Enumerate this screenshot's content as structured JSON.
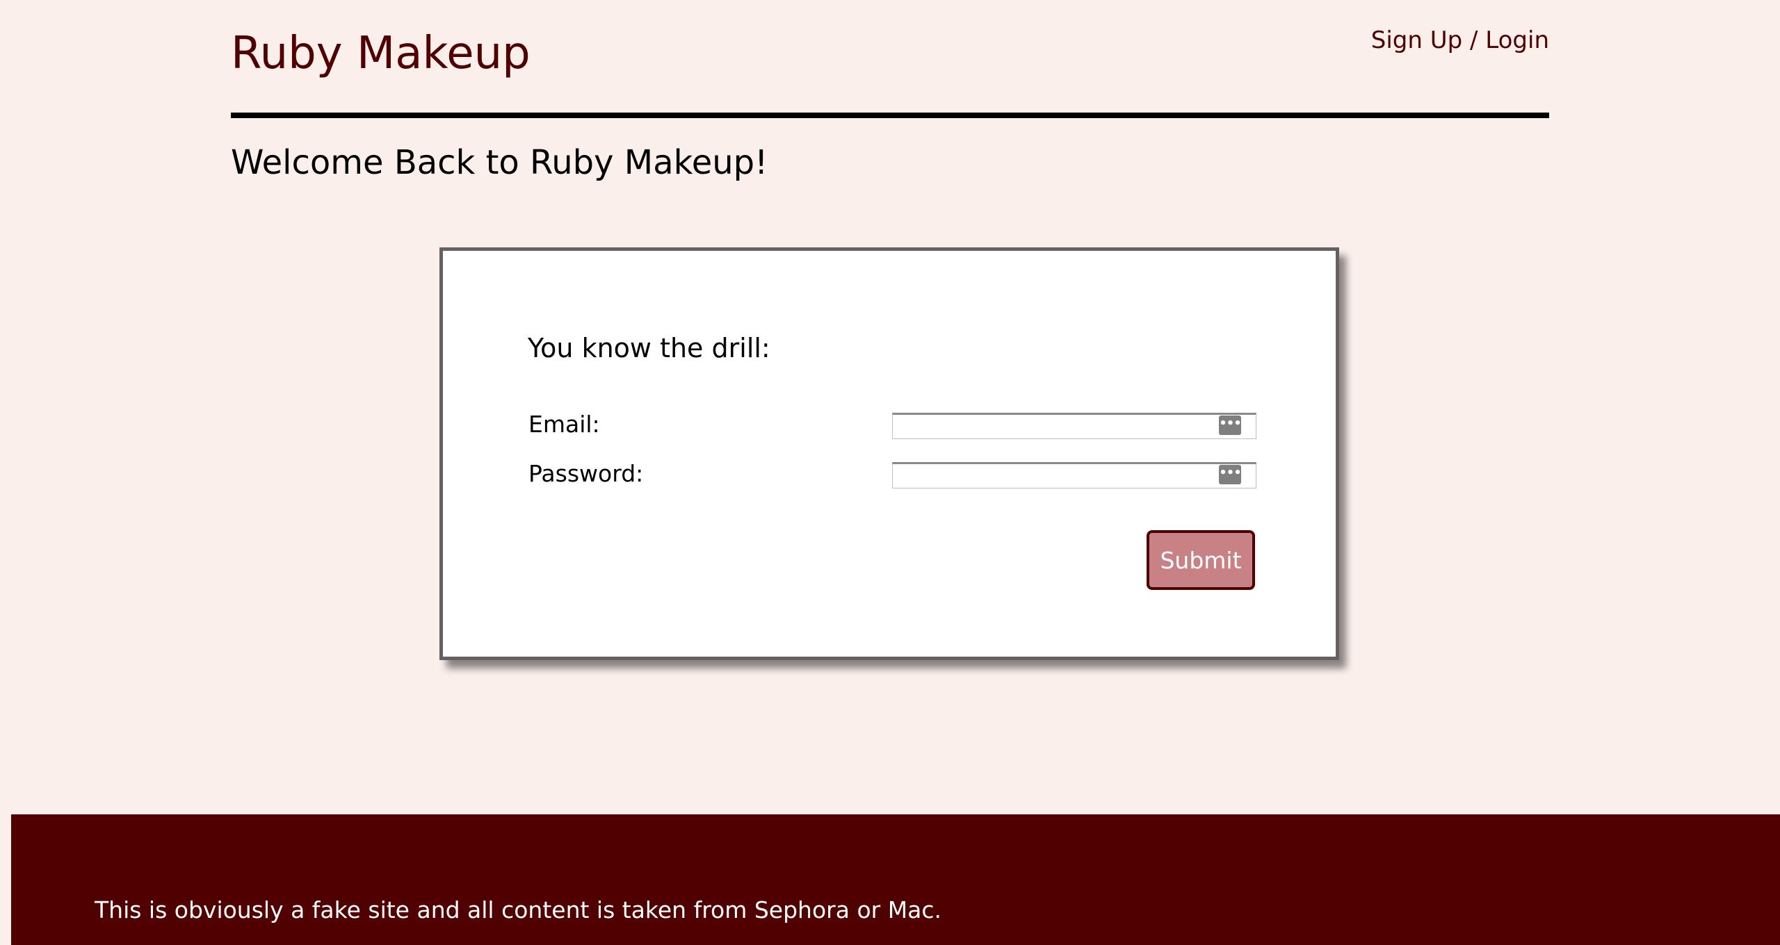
{
  "header": {
    "site_title": "Ruby Makeup",
    "auth_link": "Sign Up / Login"
  },
  "main": {
    "welcome_heading": "Welcome Back to Ruby Makeup!"
  },
  "login_form": {
    "heading": "You know the drill:",
    "email_label": "Email:",
    "email_value": "",
    "password_label": "Password:",
    "password_value": "",
    "submit_label": "Submit",
    "autofill_icon_name": "autofill-key-icon",
    "autofill_glyph": "•••"
  },
  "footer": {
    "text": "This is obviously a fake site and all content is taken from Sephora or Mac."
  },
  "colors": {
    "page_background": "#fbefeb",
    "brand": "#500000",
    "button_fill": "#c88285",
    "card_border": "#676062"
  }
}
